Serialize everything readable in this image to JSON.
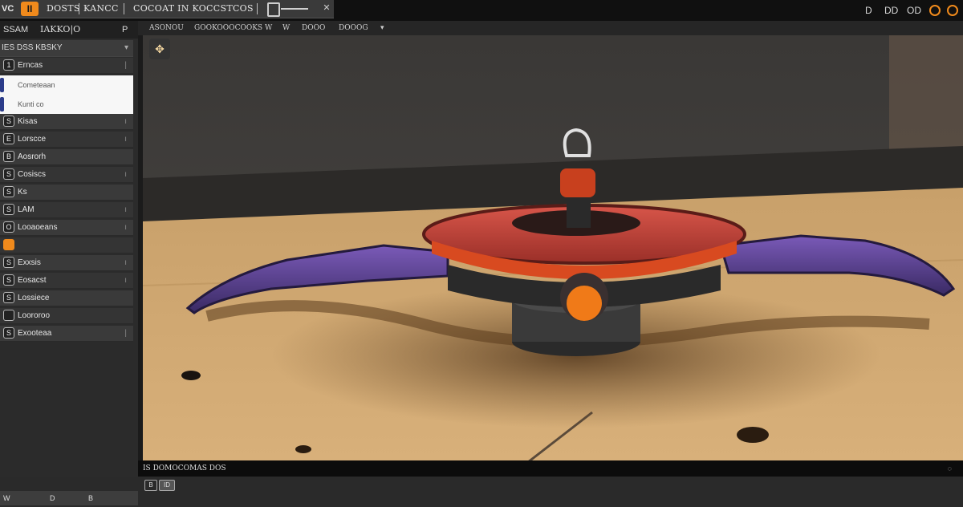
{
  "titlebar": {
    "app_mark": "VC",
    "logo_glyph": "II",
    "menu_1": "DOSTS",
    "menu_2": "KANCC",
    "menu_3": "COCOAT IN KOCCSTCOS",
    "window_controls": [
      "D",
      "DD",
      "OD",
      "O",
      "O"
    ]
  },
  "sidebar": {
    "header_left": "SSAM",
    "header_title": "IAKKO|O",
    "header_right": "P",
    "group_label": "IES DSS KBSKY",
    "items": [
      {
        "icon": "1",
        "label": "Erncas",
        "mark": "|"
      },
      {
        "icon": "",
        "label": "Cometeaan",
        "mark": "",
        "white": true
      },
      {
        "icon": "",
        "label": "Kunti co",
        "mark": "",
        "white": true
      },
      {
        "icon": "S",
        "label": "Kisas",
        "mark": "ı"
      },
      {
        "icon": "E",
        "label": "Lorscce",
        "mark": "ı"
      },
      {
        "icon": "B",
        "label": "Aosrorh",
        "mark": ""
      },
      {
        "icon": "S",
        "label": "Cosiscs",
        "mark": "ı"
      },
      {
        "icon": "S",
        "label": "Ks",
        "mark": ""
      },
      {
        "icon": "S",
        "label": "LAM",
        "mark": "ı"
      },
      {
        "icon": "O",
        "label": "Looaoeans",
        "mark": "ı"
      },
      {
        "icon": "",
        "label": "",
        "mark": "",
        "orange": true
      },
      {
        "icon": "S",
        "label": "Exxsis",
        "mark": "ı"
      },
      {
        "icon": "S",
        "label": "Eosacst",
        "mark": "ı"
      },
      {
        "icon": "S",
        "label": "Lossiece",
        "mark": ""
      },
      {
        "icon": "",
        "label": "Loororoo",
        "mark": ""
      },
      {
        "icon": "S",
        "label": "Exooteaa",
        "mark": "|"
      }
    ]
  },
  "viewport_toolbar": {
    "items": [
      "ASONOU",
      "GOOKOOOCOOKS",
      "W",
      "W",
      "DOOO",
      "DOOOG"
    ]
  },
  "status_bar": {
    "text": "IS DOMOCOMAS DOS"
  },
  "bottom_bar": {
    "left": [
      "W",
      "D",
      "B"
    ],
    "right_buttons": [
      "B",
      "ID"
    ]
  }
}
